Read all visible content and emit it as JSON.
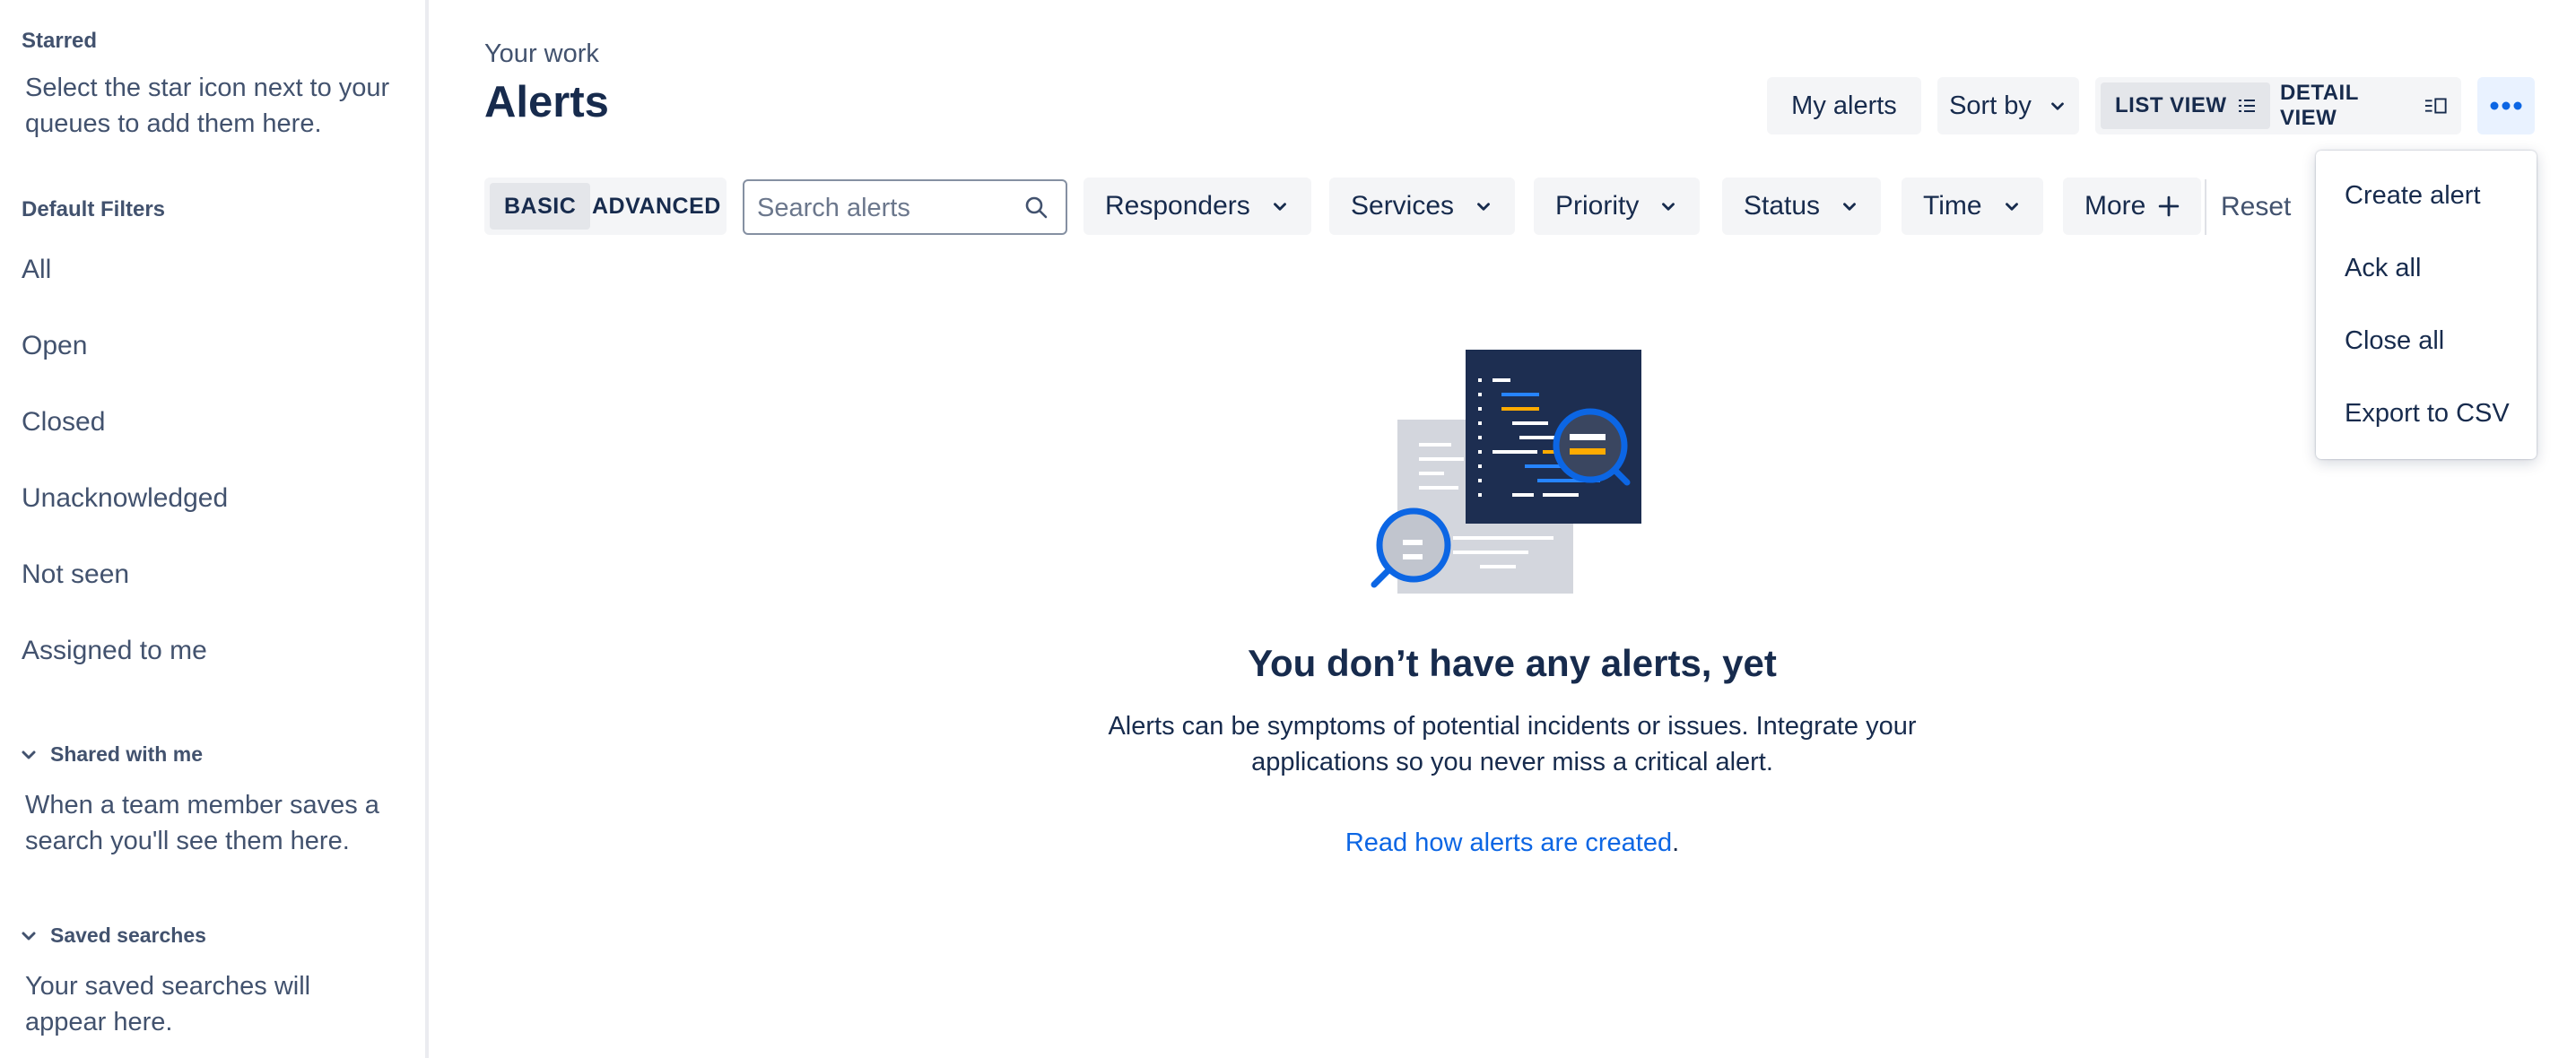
{
  "sidebar": {
    "starred": {
      "title": "Starred",
      "text": "Select the star icon next to your queues to add them here."
    },
    "default_filters": {
      "title": "Default Filters",
      "items": [
        "All",
        "Open",
        "Closed",
        "Unacknowledged",
        "Not seen",
        "Assigned to me"
      ]
    },
    "shared": {
      "title": "Shared with me",
      "text": "When a team member saves a search you'll see them here."
    },
    "saved": {
      "title": "Saved searches",
      "text": "Your saved searches will appear here."
    }
  },
  "header": {
    "breadcrumb": "Your work",
    "title": "Alerts",
    "my_alerts": "My alerts",
    "sort_by": "Sort by",
    "list_view": "LIST VIEW",
    "detail_view": "DETAIL VIEW",
    "active_view": "list"
  },
  "more_menu": {
    "items": [
      "Create alert",
      "Ack all",
      "Close all",
      "Export to CSV"
    ]
  },
  "filters": {
    "mode_basic": "BASIC",
    "mode_advanced": "ADVANCED",
    "active_mode": "basic",
    "search_placeholder": "Search alerts",
    "responders": "Responders",
    "services": "Services",
    "priority": "Priority",
    "status": "Status",
    "time": "Time",
    "more": "More",
    "reset": "Reset"
  },
  "empty_state": {
    "title": "You don’t have any alerts, yet",
    "description": "Alerts can be symptoms of potential incidents or issues. Integrate your applications so you never miss a critical alert.",
    "link_text": "Read how alerts are created",
    "link_suffix": "."
  },
  "colors": {
    "text": "#172B4D",
    "subtle_text": "#42526E",
    "link": "#0C66E4",
    "button_bg": "#F4F5F7",
    "accent_bg": "#E9F2FF"
  }
}
